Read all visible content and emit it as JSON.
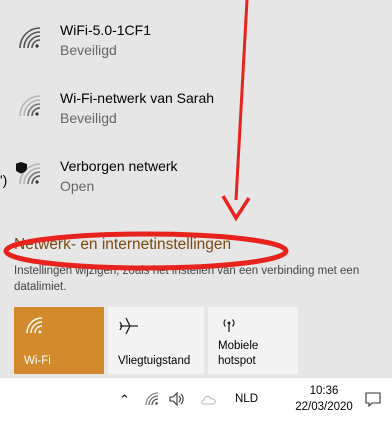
{
  "networks": [
    {
      "name": "WiFi-5.0-1CF1",
      "status": "Beveiligd"
    },
    {
      "name": "Wi-Fi-netwerk van Sarah",
      "status": "Beveiligd"
    },
    {
      "name": "Verborgen netwerk",
      "status": "Open"
    }
  ],
  "left_edge_fragment": "')",
  "settings": {
    "link_label": "Netwerk- en internetinstellingen",
    "description": "Instellingen wijzigen, zoals het instellen van een verbinding met een datalimiet."
  },
  "quick_actions": [
    {
      "label": "Wi-Fi",
      "icon": "wifi-icon",
      "active": true
    },
    {
      "label": "Vliegtuigstand",
      "icon": "airplane-icon",
      "active": false
    },
    {
      "label": "Mobiele hotspot",
      "icon": "hotspot-icon",
      "active": false
    }
  ],
  "taskbar": {
    "language": "NLD",
    "time": "10:36",
    "date": "22/03/2020"
  },
  "colors": {
    "panel_bg": "#e6e6e6",
    "accent": "#d38a2c",
    "link": "#7b4a12",
    "annotation_red": "#e8231e"
  }
}
